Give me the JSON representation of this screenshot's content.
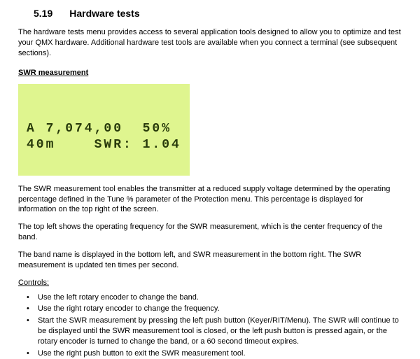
{
  "section": {
    "number": "5.19",
    "title": "Hardware tests"
  },
  "intro": "The hardware tests menu provides access to several application tools designed to allow you to optimize and test your QMX hardware. Additional hardware test tools are available when you connect a terminal (see subsequent sections).",
  "swr": {
    "heading": "SWR measurement",
    "lcd": {
      "line1": "A 7,074,00  50%",
      "line2": "40m    SWR: 1.04"
    },
    "para1": "The SWR measurement tool enables the transmitter at a reduced supply voltage determined by the operating percentage defined in the Tune % parameter of the Protection menu. This percentage is displayed for information on the top right of the screen.",
    "para2": "The top left shows the operating frequency for the SWR measurement, which is the center frequency of the band.",
    "para3": "The band name is displayed in the bottom left, and SWR measurement in the bottom right. The SWR measurement is updated ten times per second.",
    "controls_label": "Controls:",
    "controls": {
      "item1": "Use the left rotary encoder to change the band.",
      "item2": "Use the right rotary encoder to change the frequency.",
      "item3": "Start the SWR measurement by pressing the left push button (Keyer/RIT/Menu). The SWR will continue to be displayed until the SWR measurement tool is closed, or the left push button is pressed again, or the rotary encoder is turned to change the band, or a 60 second timeout expires.",
      "item4": "Use the right push button to exit the SWR measurement tool."
    }
  }
}
